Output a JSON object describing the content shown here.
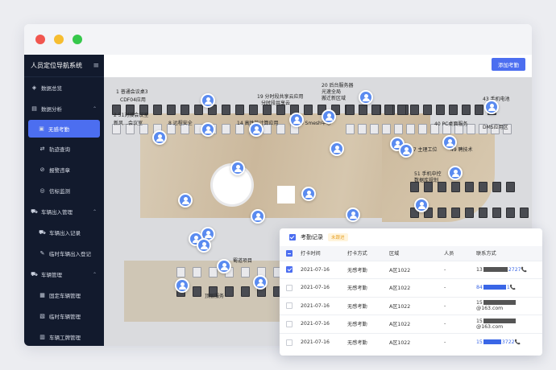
{
  "window": {
    "dots": [
      "#f1564f",
      "#f6bd30",
      "#36c84b"
    ]
  },
  "sidebar": {
    "app_title": "人员定位导航系统",
    "menu_icon": "≡",
    "items": [
      {
        "label": "数据总览",
        "icon": "dashboard-icon",
        "level": 0
      },
      {
        "label": "数据分析",
        "icon": "analysis-icon",
        "level": 0,
        "caret": "⌃"
      },
      {
        "label": "无感考勤",
        "icon": "attendance-icon",
        "level": 1,
        "active": true
      },
      {
        "label": "轨迹查询",
        "icon": "track-icon",
        "level": 1
      },
      {
        "label": "报警违章",
        "icon": "alarm-icon",
        "level": 1
      },
      {
        "label": "信标监测",
        "icon": "beacon-icon",
        "level": 1
      },
      {
        "label": "车辆出入管理",
        "icon": "car-icon",
        "level": 0,
        "caret": "⌃"
      },
      {
        "label": "车辆出入记录",
        "icon": "car-record-icon",
        "level": 1
      },
      {
        "label": "临时车辆出入登记",
        "icon": "register-icon",
        "level": 1
      },
      {
        "label": "车辆管理",
        "icon": "vehicle-icon",
        "level": 0,
        "caret": "⌃"
      },
      {
        "label": "固定车辆管理",
        "icon": "fixed-car-icon",
        "level": 1
      },
      {
        "label": "临时车辆管理",
        "icon": "temp-car-icon",
        "level": 1
      },
      {
        "label": "车辆工牌管理",
        "icon": "badge-icon",
        "level": 1
      }
    ]
  },
  "toolbar": {
    "add_label": "添加考勤"
  },
  "map": {
    "labels": [
      "1 普通会议桌3",
      "CDF04应用",
      "2 51对接会议室",
      "新风…会议室",
      "19 分时段共享云应用",
      "分时段共享云",
      "20 后台服务器",
      "光速全局",
      "搬迁新区域",
      "8 远程安全",
      "14 高性能计算应用",
      "30 Smesh中心",
      "40 PC桌面服务",
      "DMS应用区",
      "43 手机电池",
      "47 主理工位",
      "49 聘技术",
      "51 手机中控",
      "数据库规划",
      "顶层服务",
      "蜀道项目"
    ]
  },
  "panel": {
    "title": "考勤记录",
    "badge": "未跟进",
    "columns": [
      "打卡时间",
      "打卡方式",
      "区域",
      "人员",
      "联系方式"
    ],
    "rows": [
      {
        "checked": true,
        "time": "2021-07-16",
        "method": "无感考勤",
        "area": "A区1022",
        "person": "-",
        "contact_pre": "13",
        "contact_post": "2727",
        "contact_mask": "gray",
        "phone_icon": "📞"
      },
      {
        "checked": false,
        "time": "2021-07-16",
        "method": "无感考勤",
        "area": "A区1022",
        "person": "-",
        "contact_pre": "84",
        "contact_post": "1",
        "contact_mask": "blue",
        "phone_icon": "📞"
      },
      {
        "checked": false,
        "time": "2021-07-16",
        "method": "无感考勤",
        "area": "A区1022",
        "person": "-",
        "contact_pre": "15",
        "contact_post": "@163.com",
        "contact_mask": "gray",
        "phone_icon": ""
      },
      {
        "checked": false,
        "time": "2021-07-16",
        "method": "无感考勤",
        "area": "A区1022",
        "person": "-",
        "contact_pre": "15",
        "contact_post": "@163.com",
        "contact_mask": "gray",
        "phone_icon": ""
      },
      {
        "checked": false,
        "time": "2021-07-16",
        "method": "无感考勤",
        "area": "A区1022",
        "person": "-",
        "contact_pre": "15",
        "contact_post": "3722",
        "contact_mask": "blue",
        "phone_icon": "📞"
      }
    ]
  }
}
